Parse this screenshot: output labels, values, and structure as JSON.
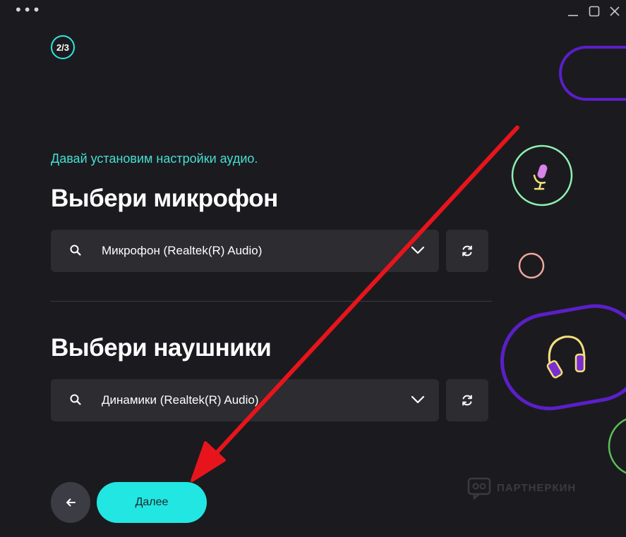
{
  "window": {
    "menu_icon": "more-dots-icon",
    "controls": [
      "minimize-icon",
      "maximize-icon",
      "close-icon"
    ]
  },
  "step": {
    "label": "2/3"
  },
  "intro_text": "Давай установим настройки аудио.",
  "microphone": {
    "heading": "Выбери микрофон",
    "selected": "Микрофон (Realtek(R) Audio)",
    "search_icon": "search-icon",
    "dropdown_icon": "chevron-down-icon",
    "refresh_icon": "refresh-icon"
  },
  "headphones": {
    "heading": "Выбери наушники",
    "selected": "Динамики (Realtek(R) Audio)",
    "search_icon": "search-icon",
    "dropdown_icon": "chevron-down-icon",
    "refresh_icon": "refresh-icon"
  },
  "nav": {
    "back_icon": "arrow-left-icon",
    "next_label": "Далее"
  },
  "watermark": {
    "text": "ПАРТНЕРКИН"
  },
  "colors": {
    "background": "#1b1b1f",
    "accent_cyan": "#22e6e2",
    "intro_text": "#45dfd3",
    "field_bg": "#2c2c31",
    "annotation_arrow": "#e8141c",
    "deco_purple": "#5b1fc9",
    "deco_green": "#8ff0b2",
    "deco_pink": "#f0a79c",
    "deco_yellow": "#f3e07a"
  }
}
